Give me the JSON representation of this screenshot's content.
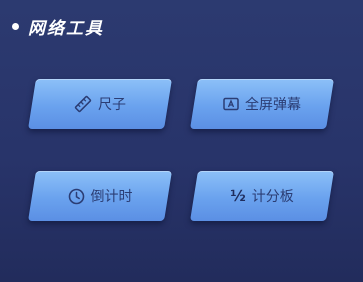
{
  "section": {
    "title": "网络工具"
  },
  "buttons": {
    "ruler": {
      "label": "尺子",
      "icon": "ruler-icon"
    },
    "barrage": {
      "label": "全屏弹幕",
      "icon": "fullscreen-barrage-icon"
    },
    "countdown": {
      "label": "倒计时",
      "icon": "clock-icon"
    },
    "scoreboard": {
      "label": "计分板",
      "icon": "half-fraction-icon",
      "icon_text": "½"
    }
  },
  "colors": {
    "background": "#2c3a70",
    "button_light": "#8cc0f8",
    "button_dark": "#5b8fe4",
    "button_text": "#2b3d74",
    "title_text": "#ffffff"
  }
}
